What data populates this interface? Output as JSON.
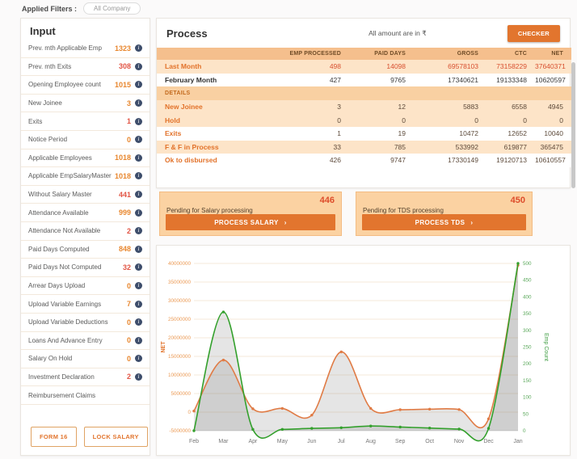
{
  "filters": {
    "label": "Applied Filters :",
    "chip": "All Company"
  },
  "icons": {
    "info": "i",
    "chevron": "›"
  },
  "sidebar": {
    "title": "Input",
    "rows": [
      {
        "label": "Prev. mth Applicable Emp",
        "value": "1323",
        "tone": "orange"
      },
      {
        "label": "Prev. mth Exits",
        "value": "308",
        "tone": "red"
      },
      {
        "label": "Opening Employee count",
        "value": "1015",
        "tone": "orange"
      },
      {
        "label": "New Joinee",
        "value": "3",
        "tone": "orange"
      },
      {
        "label": "Exits",
        "value": "1",
        "tone": "red"
      },
      {
        "label": "Notice Period",
        "value": "0",
        "tone": "orange"
      },
      {
        "label": "Applicable Employees",
        "value": "1018",
        "tone": "orange"
      },
      {
        "label": "Applicable EmpSalaryMaster",
        "value": "1018",
        "tone": "orange"
      },
      {
        "label": "Without Salary Master",
        "value": "441",
        "tone": "red"
      },
      {
        "label": "Attendance Available",
        "value": "999",
        "tone": "orange"
      },
      {
        "label": "Attendance Not Available",
        "value": "2",
        "tone": "red"
      },
      {
        "label": "Paid Days Computed",
        "value": "848",
        "tone": "orange"
      },
      {
        "label": "Paid Days Not Computed",
        "value": "32",
        "tone": "red"
      },
      {
        "label": "Arrear Days Upload",
        "value": "0",
        "tone": "orange"
      },
      {
        "label": "Upload Variable Earnings",
        "value": "7",
        "tone": "orange"
      },
      {
        "label": "Upload Variable Deductions",
        "value": "0",
        "tone": "orange"
      },
      {
        "label": "Loans And Advance Entry",
        "value": "0",
        "tone": "orange"
      },
      {
        "label": "Salary On Hold",
        "value": "0",
        "tone": "orange"
      },
      {
        "label": "Investment Declaration",
        "value": "2",
        "tone": "red"
      },
      {
        "label": "Reimbursement Claims",
        "value": "",
        "tone": "none"
      }
    ],
    "buttons": {
      "form16": "FORM 16",
      "lock": "LOCK SALARY"
    }
  },
  "process": {
    "title": "Process",
    "note": "All amount are in ₹",
    "checker": "CHECKER",
    "table": {
      "columns": [
        "",
        "EMP PROCESSED",
        "PAID DAYS",
        "GROSS",
        "CTC",
        "NET"
      ],
      "rows": [
        {
          "label": "Last Month",
          "values": [
            "498",
            "14098",
            "69578103",
            "73158229",
            "37640371"
          ],
          "style": "lastmonth"
        },
        {
          "label": "February Month",
          "values": [
            "427",
            "9765",
            "17340621",
            "19133348",
            "10620597"
          ],
          "style": "current"
        },
        {
          "label": "DETAILS",
          "values": [],
          "style": "section"
        },
        {
          "label": "New Joinee",
          "values": [
            "3",
            "12",
            "5883",
            "6558",
            "4945"
          ],
          "style": "peach"
        },
        {
          "label": "Hold",
          "values": [
            "0",
            "0",
            "0",
            "0",
            "0"
          ],
          "style": "peach"
        },
        {
          "label": "Exits",
          "values": [
            "1",
            "19",
            "10472",
            "12652",
            "10040"
          ],
          "style": "white"
        },
        {
          "label": "F & F in Process",
          "values": [
            "33",
            "785",
            "533992",
            "619877",
            "365475"
          ],
          "style": "peach"
        },
        {
          "label": "Ok to disbursed",
          "values": [
            "426",
            "9747",
            "17330149",
            "19120713",
            "10610557"
          ],
          "style": "white"
        }
      ]
    }
  },
  "pending": [
    {
      "label": "Pending for Salary processing",
      "count": "446",
      "button": "PROCESS SALARY"
    },
    {
      "label": "Pending for TDS processing",
      "count": "450",
      "button": "PROCESS TDS"
    }
  ],
  "chart_data": {
    "type": "line",
    "x": [
      "Feb",
      "Mar",
      "Apr",
      "May",
      "Jun",
      "Jul",
      "Aug",
      "Sep",
      "Oct",
      "Nov",
      "Dec",
      "Jan"
    ],
    "series": [
      {
        "name": "NET",
        "axis": "left",
        "color": "#e07b45",
        "values": [
          300000,
          14000000,
          900000,
          1000000,
          -800000,
          16200000,
          1000000,
          650000,
          800000,
          700000,
          -1800000,
          39500000
        ]
      },
      {
        "name": "Emp Count",
        "axis": "right",
        "color": "#33a02c",
        "values": [
          0,
          355,
          4,
          4,
          7,
          9,
          14,
          11,
          8,
          5,
          7,
          500
        ]
      }
    ],
    "left_axis": {
      "label": "NET",
      "min": -5000000,
      "max": 40000000,
      "step": 5000000,
      "color": "#eb9a55",
      "title_color": "#e2752e"
    },
    "right_axis": {
      "label": "Emp Count",
      "min": 0,
      "max": 500,
      "step": 50,
      "color": "#5aa85a",
      "title_color": "#3f9d42"
    },
    "area_fill": "rgba(110,110,110,0.18)",
    "grid": true,
    "legend": "none"
  }
}
